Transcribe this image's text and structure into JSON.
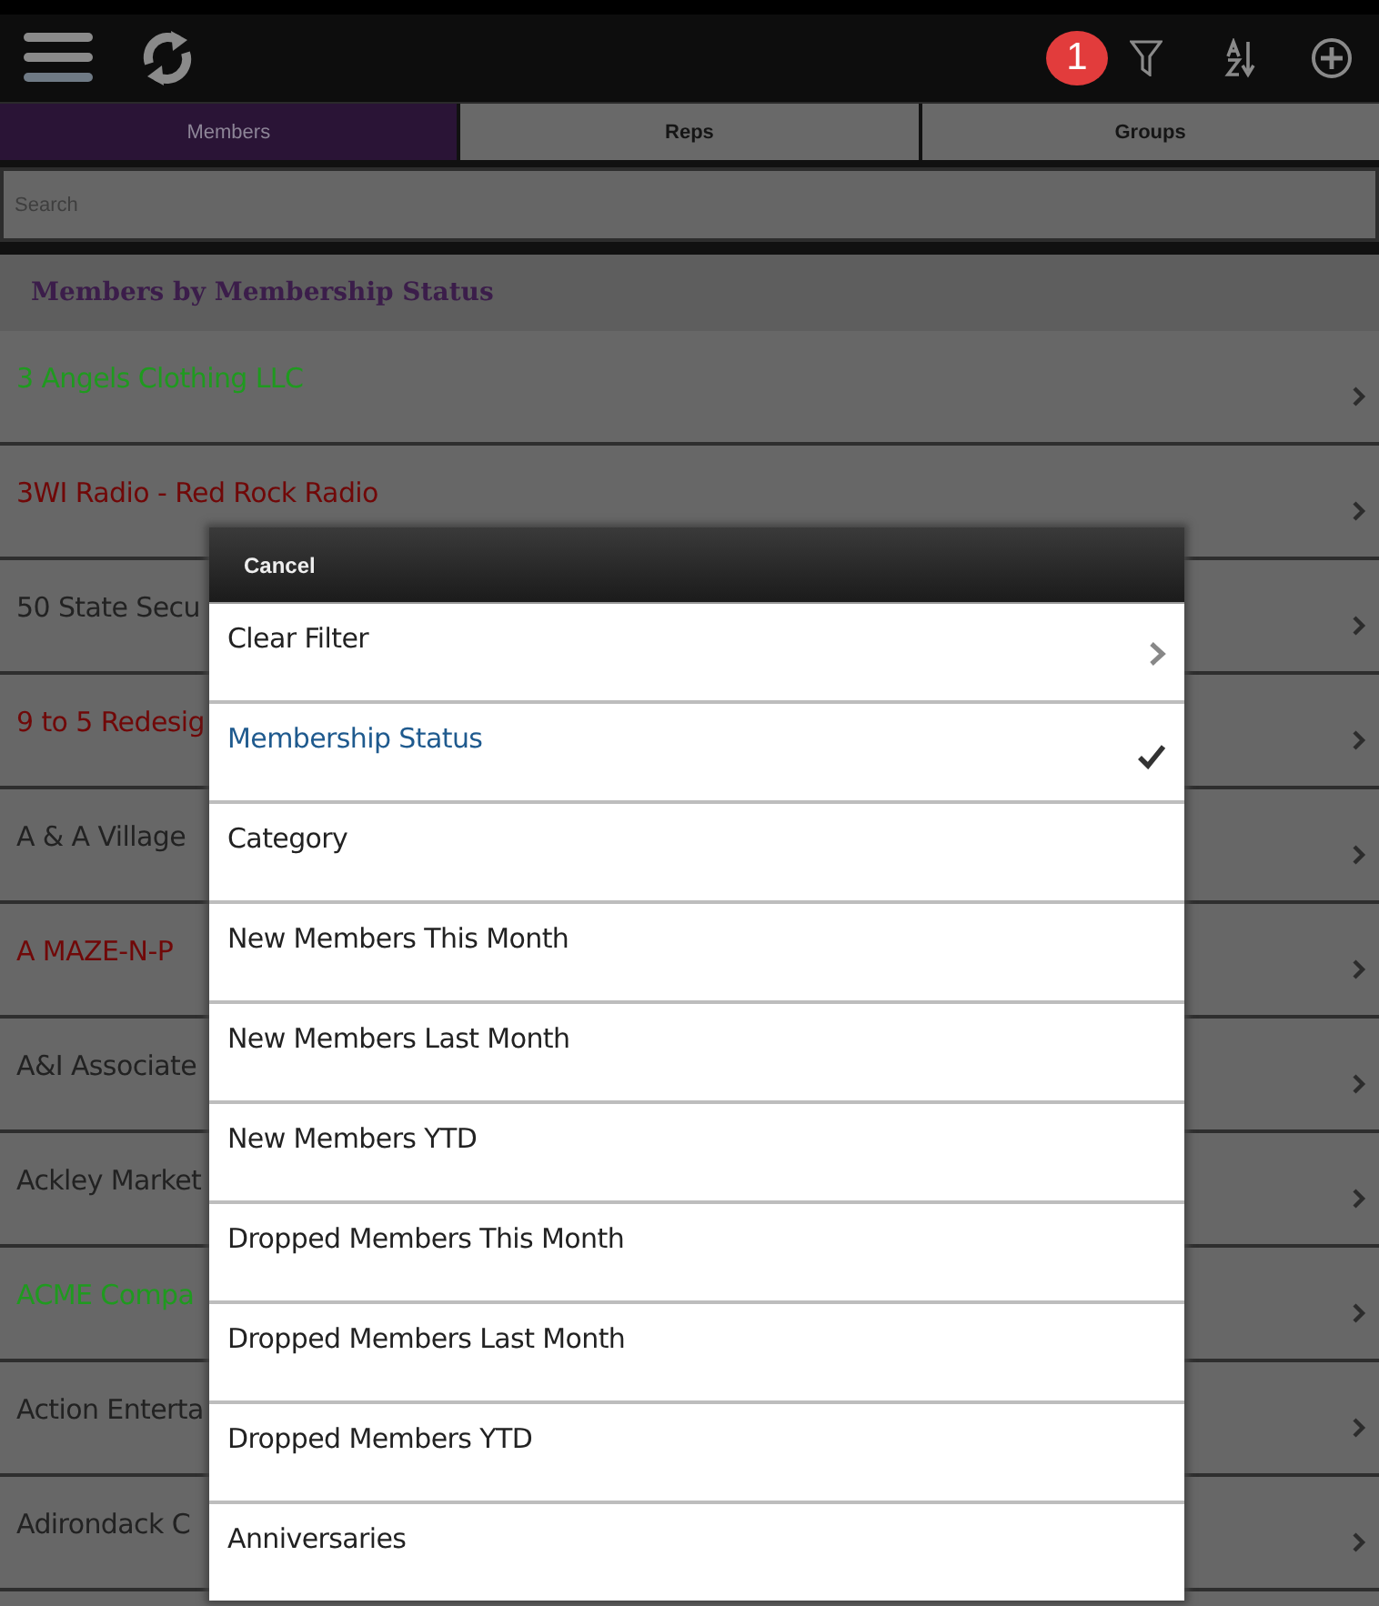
{
  "toolbar": {
    "badge": "1"
  },
  "tabs": [
    {
      "label": "Members",
      "selected": true
    },
    {
      "label": "Reps",
      "selected": false
    },
    {
      "label": "Groups",
      "selected": false
    }
  ],
  "search": {
    "placeholder": "Search"
  },
  "section_title": "Members by Membership Status",
  "members": [
    {
      "name": "3 Angels Clothing LLC",
      "color": "#1f9a1f"
    },
    {
      "name": "3WI Radio - Red Rock Radio",
      "color": "#700808"
    },
    {
      "name": "50 State Secu",
      "color": "#222222"
    },
    {
      "name": "9 to 5 Redesig",
      "color": "#700808"
    },
    {
      "name": "A & A Village",
      "color": "#222222"
    },
    {
      "name": "A MAZE-N-P",
      "color": "#700808"
    },
    {
      "name": "A&I Associate",
      "color": "#222222"
    },
    {
      "name": "Ackley Market",
      "color": "#222222"
    },
    {
      "name": "ACME Compa",
      "color": "#1f9a1f"
    },
    {
      "name": "Action Enterta",
      "color": "#222222"
    },
    {
      "name": "Adirondack C",
      "color": "#222222"
    }
  ],
  "filter_menu": {
    "cancel": "Cancel",
    "items": [
      {
        "label": "Clear Filter",
        "kind": "link",
        "selected": false
      },
      {
        "label": "Membership Status",
        "kind": "option",
        "selected": true
      },
      {
        "label": "Category",
        "kind": "option",
        "selected": false
      },
      {
        "label": "New Members This Month",
        "kind": "option",
        "selected": false
      },
      {
        "label": "New Members Last Month",
        "kind": "option",
        "selected": false
      },
      {
        "label": "New Members YTD",
        "kind": "option",
        "selected": false
      },
      {
        "label": "Dropped Members This Month",
        "kind": "option",
        "selected": false
      },
      {
        "label": "Dropped Members Last Month",
        "kind": "option",
        "selected": false
      },
      {
        "label": "Dropped Members YTD",
        "kind": "option",
        "selected": false
      },
      {
        "label": "Anniversaries",
        "kind": "option",
        "selected": false
      }
    ]
  }
}
